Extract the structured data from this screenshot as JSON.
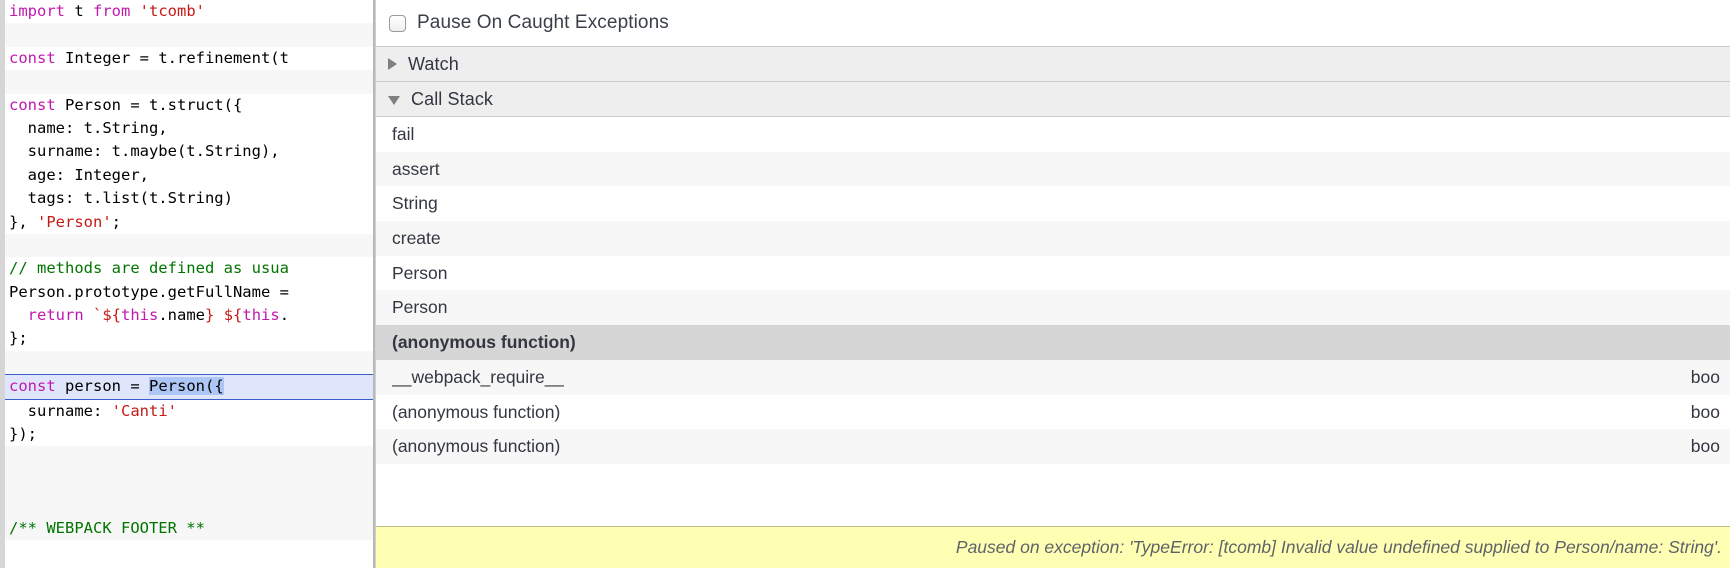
{
  "source_pane": {
    "name": "source-code-editor",
    "language": "javascript",
    "lines": [
      {
        "n": 1,
        "alt": false,
        "exec": false,
        "tokens": [
          {
            "t": "import ",
            "c": "kw"
          },
          {
            "t": "t ",
            "c": "pln"
          },
          {
            "t": "from ",
            "c": "kw"
          },
          {
            "t": "'tcomb'",
            "c": "str"
          }
        ]
      },
      {
        "n": 2,
        "alt": true,
        "exec": false,
        "tokens": []
      },
      {
        "n": 3,
        "alt": false,
        "exec": false,
        "tokens": [
          {
            "t": "const ",
            "c": "kw"
          },
          {
            "t": "Integer = t.refinement(t",
            "c": "pln"
          }
        ]
      },
      {
        "n": 4,
        "alt": true,
        "exec": false,
        "tokens": []
      },
      {
        "n": 5,
        "alt": false,
        "exec": false,
        "tokens": [
          {
            "t": "const ",
            "c": "kw"
          },
          {
            "t": "Person = t.struct({",
            "c": "pln"
          }
        ]
      },
      {
        "n": 6,
        "alt": false,
        "exec": false,
        "tokens": [
          {
            "t": "  name: t.String,",
            "c": "pln"
          }
        ]
      },
      {
        "n": 7,
        "alt": false,
        "exec": false,
        "tokens": [
          {
            "t": "  surname: t.maybe(t.String),",
            "c": "pln"
          }
        ]
      },
      {
        "n": 8,
        "alt": false,
        "exec": false,
        "tokens": [
          {
            "t": "  age: Integer,",
            "c": "pln"
          }
        ]
      },
      {
        "n": 9,
        "alt": false,
        "exec": false,
        "tokens": [
          {
            "t": "  tags: t.list(t.String)",
            "c": "pln"
          }
        ]
      },
      {
        "n": 10,
        "alt": false,
        "exec": false,
        "tokens": [
          {
            "t": "}, ",
            "c": "pln"
          },
          {
            "t": "'Person'",
            "c": "str"
          },
          {
            "t": ";",
            "c": "pln"
          }
        ]
      },
      {
        "n": 11,
        "alt": true,
        "exec": false,
        "tokens": []
      },
      {
        "n": 12,
        "alt": false,
        "exec": false,
        "tokens": [
          {
            "t": "// methods are defined as usua",
            "c": "com"
          }
        ]
      },
      {
        "n": 13,
        "alt": false,
        "exec": false,
        "tokens": [
          {
            "t": "Person.prototype.getFullName =",
            "c": "pln"
          }
        ]
      },
      {
        "n": 14,
        "alt": false,
        "exec": false,
        "tokens": [
          {
            "t": "  ",
            "c": "pln"
          },
          {
            "t": "return ",
            "c": "kw"
          },
          {
            "t": "`",
            "c": "str"
          },
          {
            "t": "${",
            "c": "str"
          },
          {
            "t": "this",
            "c": "kw"
          },
          {
            "t": ".name",
            "c": "pln"
          },
          {
            "t": "} ",
            "c": "str"
          },
          {
            "t": "${",
            "c": "str"
          },
          {
            "t": "this",
            "c": "kw"
          },
          {
            "t": ".",
            "c": "pln"
          }
        ]
      },
      {
        "n": 15,
        "alt": false,
        "exec": false,
        "tokens": [
          {
            "t": "};",
            "c": "pln"
          }
        ]
      },
      {
        "n": 16,
        "alt": true,
        "exec": false,
        "tokens": []
      },
      {
        "n": 17,
        "alt": false,
        "exec": true,
        "tokens": [
          {
            "t": "const ",
            "c": "kw"
          },
          {
            "t": "person = ",
            "c": "pln"
          },
          {
            "t": "Person({",
            "c": "sel"
          }
        ]
      },
      {
        "n": 18,
        "alt": false,
        "exec": false,
        "tokens": [
          {
            "t": "  surname: ",
            "c": "pln"
          },
          {
            "t": "'Canti'",
            "c": "str"
          }
        ]
      },
      {
        "n": 19,
        "alt": false,
        "exec": false,
        "tokens": [
          {
            "t": "});",
            "c": "pln"
          }
        ]
      },
      {
        "n": 20,
        "alt": true,
        "exec": false,
        "tokens": []
      },
      {
        "n": 21,
        "alt": true,
        "exec": false,
        "tokens": []
      },
      {
        "n": 22,
        "alt": true,
        "exec": false,
        "tokens": []
      },
      {
        "n": 23,
        "alt": true,
        "exec": false,
        "tokens": [
          {
            "t": "/** WEBPACK FOOTER **",
            "c": "com"
          }
        ]
      }
    ]
  },
  "debugger": {
    "pause_on_caught": {
      "label": "Pause On Caught Exceptions",
      "checked": false,
      "icon": "checkbox-unchecked-icon"
    },
    "sections": {
      "watch": {
        "title": "Watch",
        "expanded": false,
        "icon": "triangle-right-icon"
      },
      "call_stack": {
        "title": "Call Stack",
        "expanded": true,
        "icon": "triangle-down-icon"
      }
    },
    "call_stack": [
      {
        "fn": "fail",
        "loc": "",
        "selected": false,
        "alt": false
      },
      {
        "fn": "assert",
        "loc": "",
        "selected": false,
        "alt": true
      },
      {
        "fn": "String",
        "loc": "",
        "selected": false,
        "alt": false
      },
      {
        "fn": "create",
        "loc": "",
        "selected": false,
        "alt": true
      },
      {
        "fn": "Person",
        "loc": "",
        "selected": false,
        "alt": false
      },
      {
        "fn": "Person",
        "loc": "",
        "selected": false,
        "alt": true
      },
      {
        "fn": "(anonymous function)",
        "loc": "",
        "selected": true,
        "alt": false
      },
      {
        "fn": "__webpack_require__",
        "loc": "boo",
        "selected": false,
        "alt": true
      },
      {
        "fn": "(anonymous function)",
        "loc": "boo",
        "selected": false,
        "alt": false
      },
      {
        "fn": "(anonymous function)",
        "loc": "boo",
        "selected": false,
        "alt": true
      }
    ],
    "status": {
      "text": "Paused on exception: 'TypeError: [tcomb] Invalid value undefined supplied to Person/name: String'.",
      "background": "#ffffb4"
    }
  },
  "colors": {
    "keyword": "#c218b0",
    "string": "#c41a16",
    "comment": "#007400",
    "plain": "#000000",
    "exec_line_bg": "#dfe6fb",
    "exec_line_border": "#3b5ecc",
    "selection": "#aec6f5",
    "section_header_bg": "#eeeeee",
    "row_alt_bg": "#f7f7f7",
    "row_selected_bg": "#d6d6d6",
    "status_bg": "#ffffb4"
  }
}
